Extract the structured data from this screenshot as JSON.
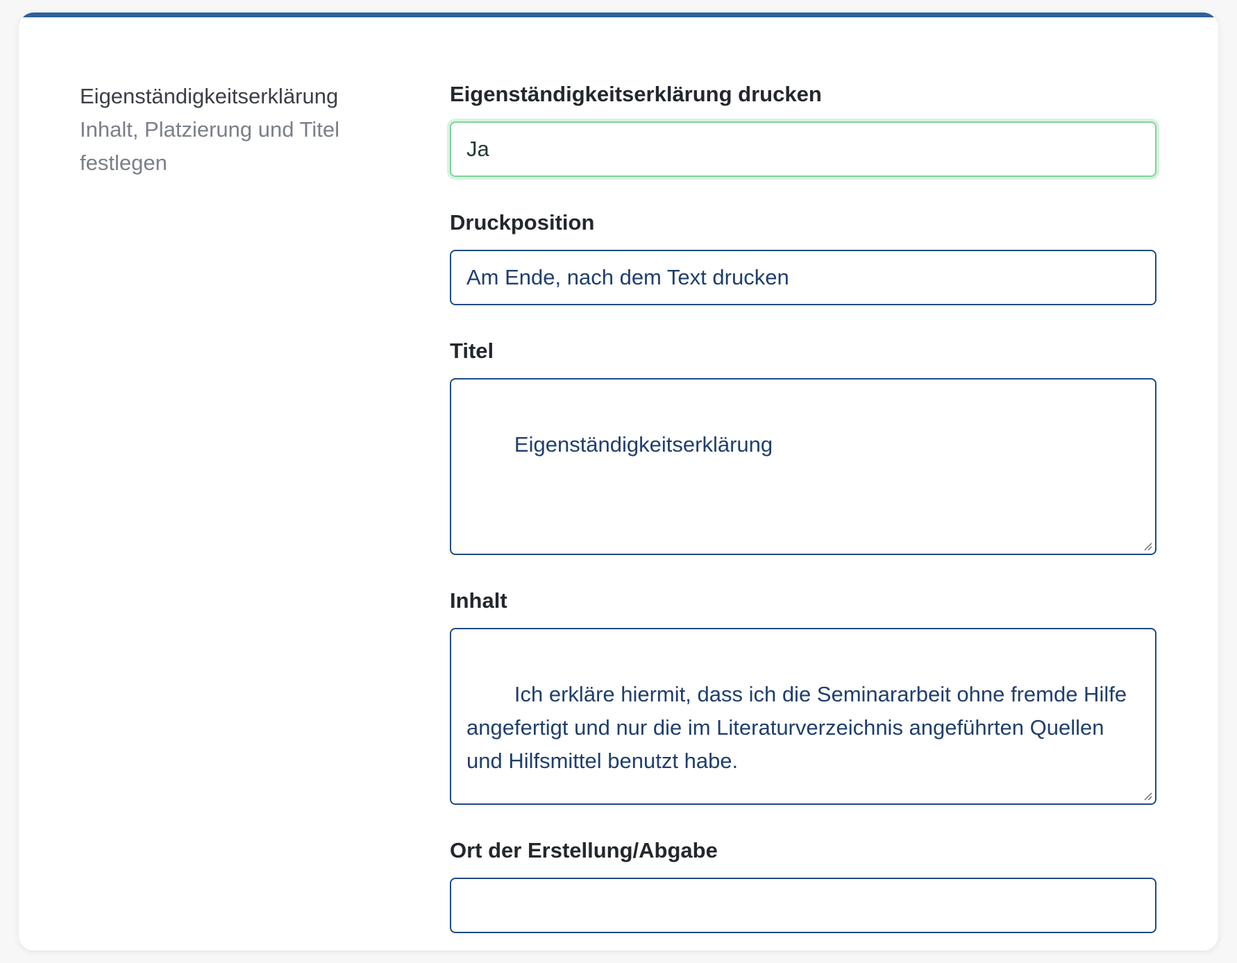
{
  "section": {
    "title": "Eigenständigkeitserklärung",
    "description": "Inhalt, Platzierung und Titel festlegen"
  },
  "form": {
    "print_label": "Eigenständigkeitserklärung drucken",
    "print_value": "Ja",
    "position_label": "Druckposition",
    "position_value": "Am Ende, nach dem Text drucken",
    "title_label": "Titel",
    "title_value": "Eigenständigkeitserklärung",
    "content_label": "Inhalt",
    "content_value": "Ich erkläre hiermit, dass ich die Seminararbeit ohne fremde Hilfe angefertigt und nur die im Literaturverzeichnis angeführten Quellen und Hilfsmittel benutzt habe.",
    "place_label": "Ort der Erstellung/Abgabe",
    "place_value": ""
  },
  "colors": {
    "accent_bar": "#2f619c",
    "field_border": "#1e4a82",
    "valid_border": "#7fd39a"
  }
}
